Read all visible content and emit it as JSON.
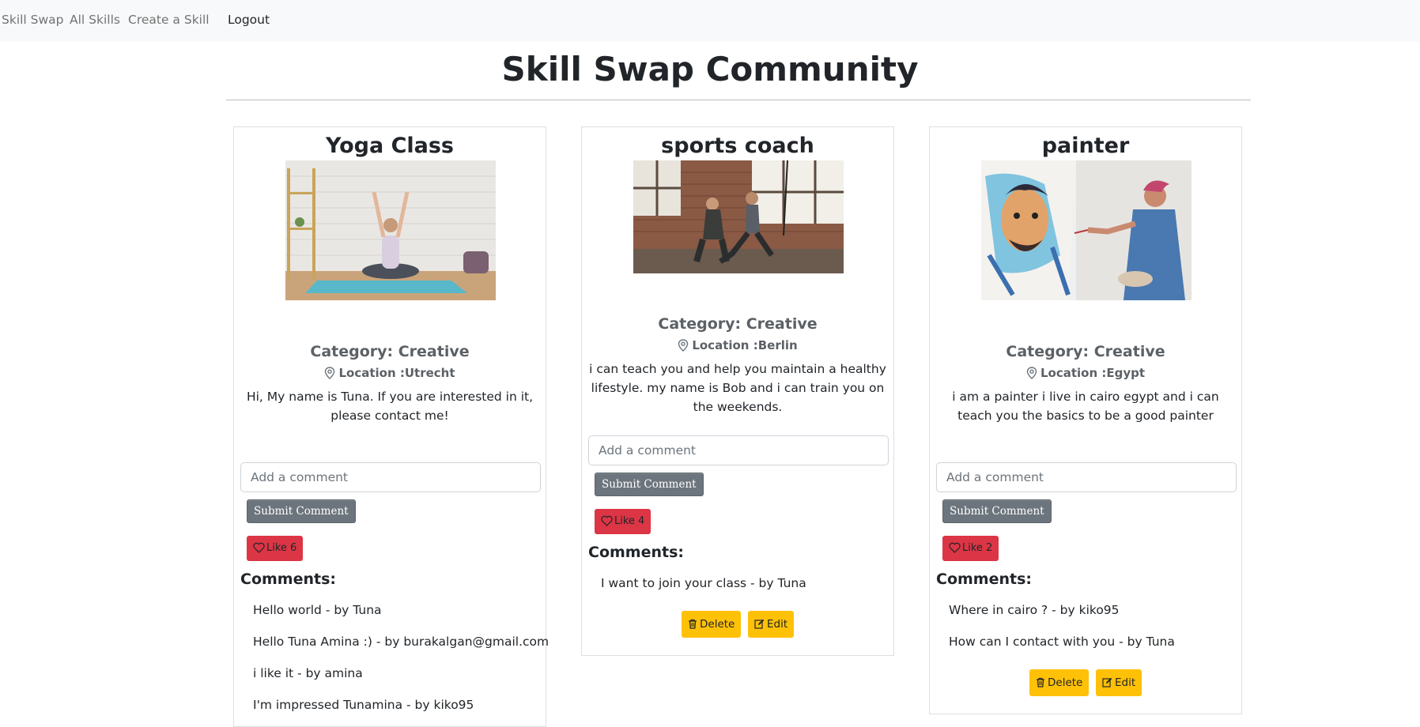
{
  "nav": {
    "brand": "Skill Swap",
    "all_skills": "All Skills",
    "create_skill": "Create a Skill",
    "logout": "Logout"
  },
  "page_title": "Skill Swap Community",
  "cards": [
    {
      "title": "Yoga Class",
      "image": "woman doing yoga stretch on mat",
      "category": "Category: Creative",
      "location": "Location :Utrecht",
      "description": "Hi, My name is Tuna. If you are interested in it, please contact me!",
      "comment_placeholder": "Add a comment",
      "submit_label": "Submit Comment",
      "like_label": "Like 6",
      "comments_heading": "Comments:",
      "comments": [
        "Hello world - by Tuna",
        "Hello Tuna Amina :) - by burakalgan@gmail.com",
        "i like it - by amina",
        "I'm impressed Tunamina - by kiko95"
      ]
    },
    {
      "title": "sports coach",
      "image": "coach training a woman in a gym",
      "category": "Category: Creative",
      "location": "Location :Berlin",
      "description": "i can teach you and help you maintain a healthy lifestyle. my name is Bob and i can train you on the weekends.",
      "comment_placeholder": "Add a comment",
      "submit_label": "Submit Comment",
      "like_label": "Like 4",
      "comments_heading": "Comments:",
      "comments": [
        "I want to join your class - by Tuna"
      ],
      "delete_label": "Delete",
      "edit_label": "Edit"
    },
    {
      "title": "painter",
      "image": "woman painting a colorful portrait",
      "category": "Category: Creative",
      "location": "Location :Egypt",
      "description": "i am a painter i live in cairo egypt and i can teach you the basics to be a good painter",
      "comment_placeholder": "Add a comment",
      "submit_label": "Submit Comment",
      "like_label": "Like 2",
      "comments_heading": "Comments:",
      "comments": [
        "Where in cairo ? - by kiko95",
        "How can I contact with you - by Tuna"
      ],
      "delete_label": "Delete",
      "edit_label": "Edit"
    }
  ],
  "colors": {
    "navbar_bg": "#f8f9fa",
    "like_red": "#dc3545",
    "action_yellow": "#ffc107",
    "submit_gray": "#6c757d"
  }
}
